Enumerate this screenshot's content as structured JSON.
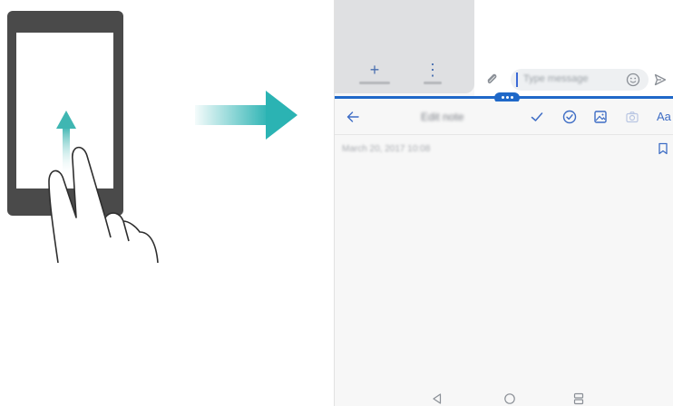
{
  "illustration": {
    "gesture": "two-finger swipe up",
    "phone_frame_color": "#4a4a4a",
    "arrow_color": "#2bb3b3",
    "gesture_arrow_color": "#3fb6b2"
  },
  "top_left_app": {
    "buttons": [
      {
        "icon": "plus-icon",
        "glyph": "+"
      },
      {
        "icon": "more-vertical-icon",
        "glyph": "⋮"
      }
    ]
  },
  "top_right_app": {
    "message_placeholder": "Type message",
    "icons": [
      "attach-icon",
      "emoji-icon",
      "send-icon"
    ]
  },
  "split_divider": {
    "color": "#1f68c8"
  },
  "bottom_app": {
    "title": "Edit note",
    "toolbar_icons": [
      "back-icon",
      "check-icon",
      "checklist-icon",
      "image-icon",
      "camera-icon",
      "font-icon"
    ],
    "font_label": "Aa",
    "note_date": "March 20, 2017 10:08"
  },
  "navbar": {
    "icons": [
      "nav-back-icon",
      "nav-home-icon",
      "nav-recent-icon"
    ]
  }
}
